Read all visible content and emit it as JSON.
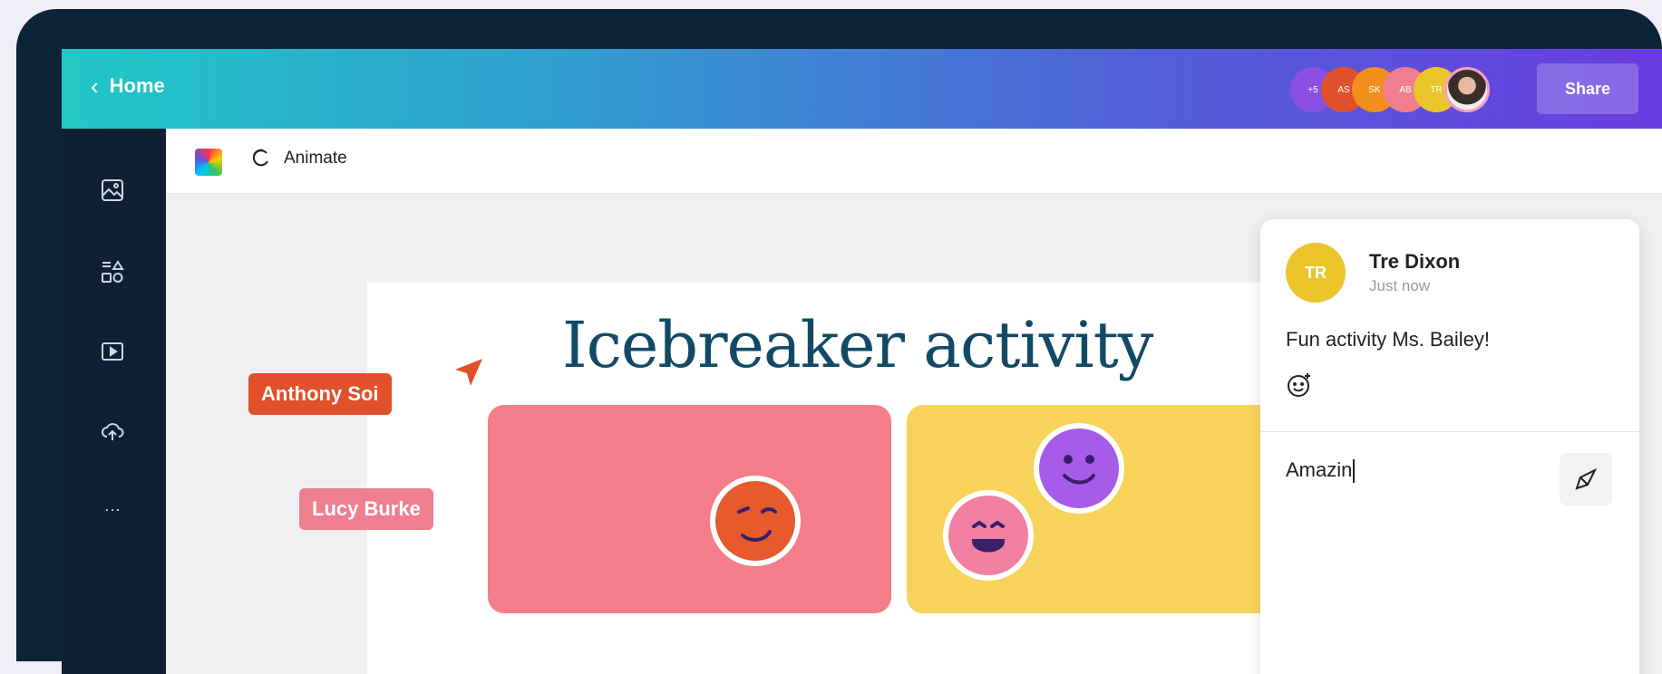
{
  "header": {
    "back_label": "Home",
    "share_label": "Share",
    "collaborators": [
      {
        "initials": "+5",
        "color": "#8a4fe0"
      },
      {
        "initials": "AS",
        "color": "#e0502a"
      },
      {
        "initials": "SK",
        "color": "#f28e1c"
      },
      {
        "initials": "AB",
        "color": "#ef7f8e"
      },
      {
        "initials": "TR",
        "color": "#ecc52c"
      }
    ]
  },
  "sidebar": {
    "items": [
      {
        "icon": "image-icon"
      },
      {
        "icon": "elements-icon"
      },
      {
        "icon": "video-icon"
      },
      {
        "icon": "upload-icon"
      },
      {
        "icon": "more-icon",
        "label": "···"
      }
    ]
  },
  "toolbar": {
    "animate_label": "Animate"
  },
  "canvas": {
    "title": "Icebreaker activity",
    "cursors": [
      {
        "name": "Anthony Soi",
        "color": "#e0502a"
      },
      {
        "name": "Lucy Burke",
        "color": "#ef7f8e"
      }
    ],
    "cards": [
      {
        "color": "#f47d8a"
      },
      {
        "color": "#f8d35c"
      }
    ]
  },
  "comment": {
    "author_initials": "TR",
    "author_name": "Tre Dixon",
    "time": "Just now",
    "text": "Fun activity Ms. Bailey!",
    "reply_value": "Amazin"
  },
  "colors": {
    "brand_gradient_start": "#21c8c6",
    "brand_gradient_end": "#6a3ce0",
    "sidebar_bg": "#0f2035"
  }
}
